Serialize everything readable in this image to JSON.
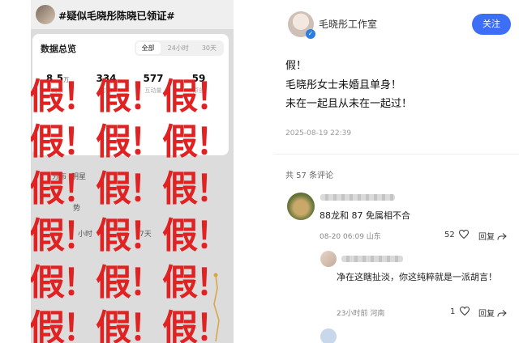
{
  "left": {
    "title": "#疑似毛晓彤陈晓已领证#",
    "card_title": "数据总览",
    "tabs": [
      "全部",
      "24小时",
      "30天"
    ],
    "stats": [
      {
        "value": "8.5",
        "unit": "万",
        "label": "阅读"
      },
      {
        "value": "334",
        "unit": "",
        "label": "讨论"
      },
      {
        "value": "577",
        "unit": "",
        "label": "互动量"
      },
      {
        "value": "59",
        "unit": "",
        "label": "原创"
      }
    ],
    "labels": {
      "dist": "分布",
      "brand": "明星",
      "trend": "势",
      "hours": "小时",
      "days": "7天"
    },
    "overlay": {
      "row1": "假！假！假！",
      "row2": "假！假！假！",
      "row3": "假！假！假！",
      "row4": "假！假！假！",
      "row5": "假！假！假！",
      "row6": "假！假！假！"
    },
    "overlay_color": "#e02222"
  },
  "post": {
    "author": "毛晓彤工作室",
    "follow_label": "关注",
    "lines": [
      "假！",
      "毛晓彤女士未婚且单身！",
      "未在一起且从未在一起过！"
    ],
    "time": "2025-08-19 22:39",
    "comment_count": "共 57 条评论",
    "accent": "#3c6ff5"
  },
  "comments": [
    {
      "text": "88龙和 87 免属相不合",
      "meta": "08-20 06:09  山东",
      "likes": "52",
      "reply_label": "回复"
    },
    {
      "text": "净在这瞎扯淡，你这纯粹就是一派胡言！",
      "meta": "23小时前  河南",
      "likes": "1",
      "reply_label": "回复"
    }
  ]
}
